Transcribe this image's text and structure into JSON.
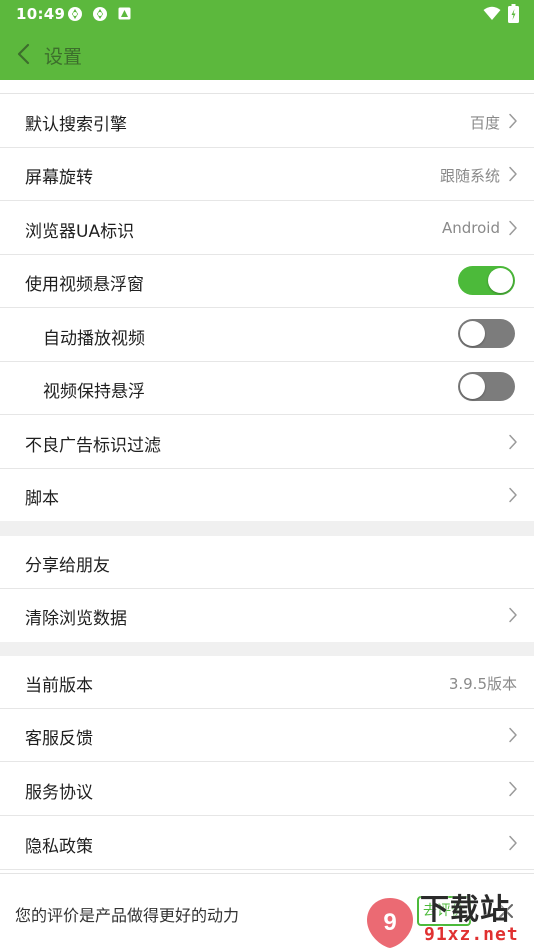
{
  "status_bar": {
    "time": "10:49"
  },
  "app_bar": {
    "title": "设置"
  },
  "rows": {
    "search_engine": {
      "label": "默认搜索引擎",
      "value": "百度"
    },
    "screen_rotation": {
      "label": "屏幕旋转",
      "value": "跟随系统"
    },
    "browser_ua": {
      "label": "浏览器UA标识",
      "value": "Android"
    },
    "video_float": {
      "label": "使用视频悬浮窗",
      "on": true
    },
    "auto_play": {
      "label": "自动播放视频",
      "on": false
    },
    "keep_float": {
      "label": "视频保持悬浮",
      "on": false
    },
    "ad_filter": {
      "label": "不良广告标识过滤"
    },
    "scripts": {
      "label": "脚本"
    },
    "share": {
      "label": "分享给朋友"
    },
    "clear_data": {
      "label": "清除浏览数据"
    },
    "version": {
      "label": "当前版本",
      "value": "3.9.5版本"
    },
    "feedback": {
      "label": "客服反馈"
    },
    "service_agreement": {
      "label": "服务协议"
    },
    "privacy_policy": {
      "label": "隐私政策"
    }
  },
  "rating_bar": {
    "message": "您的评价是产品做得更好的动力",
    "button": "去评价"
  },
  "watermark": {
    "main": "下载站",
    "url": "91xz.net"
  },
  "colors": {
    "accent": "#5cb83d",
    "toggle_on": "#4cba3a",
    "toggle_off": "#7c7c7c",
    "section_gap": "#f0f0f0"
  }
}
